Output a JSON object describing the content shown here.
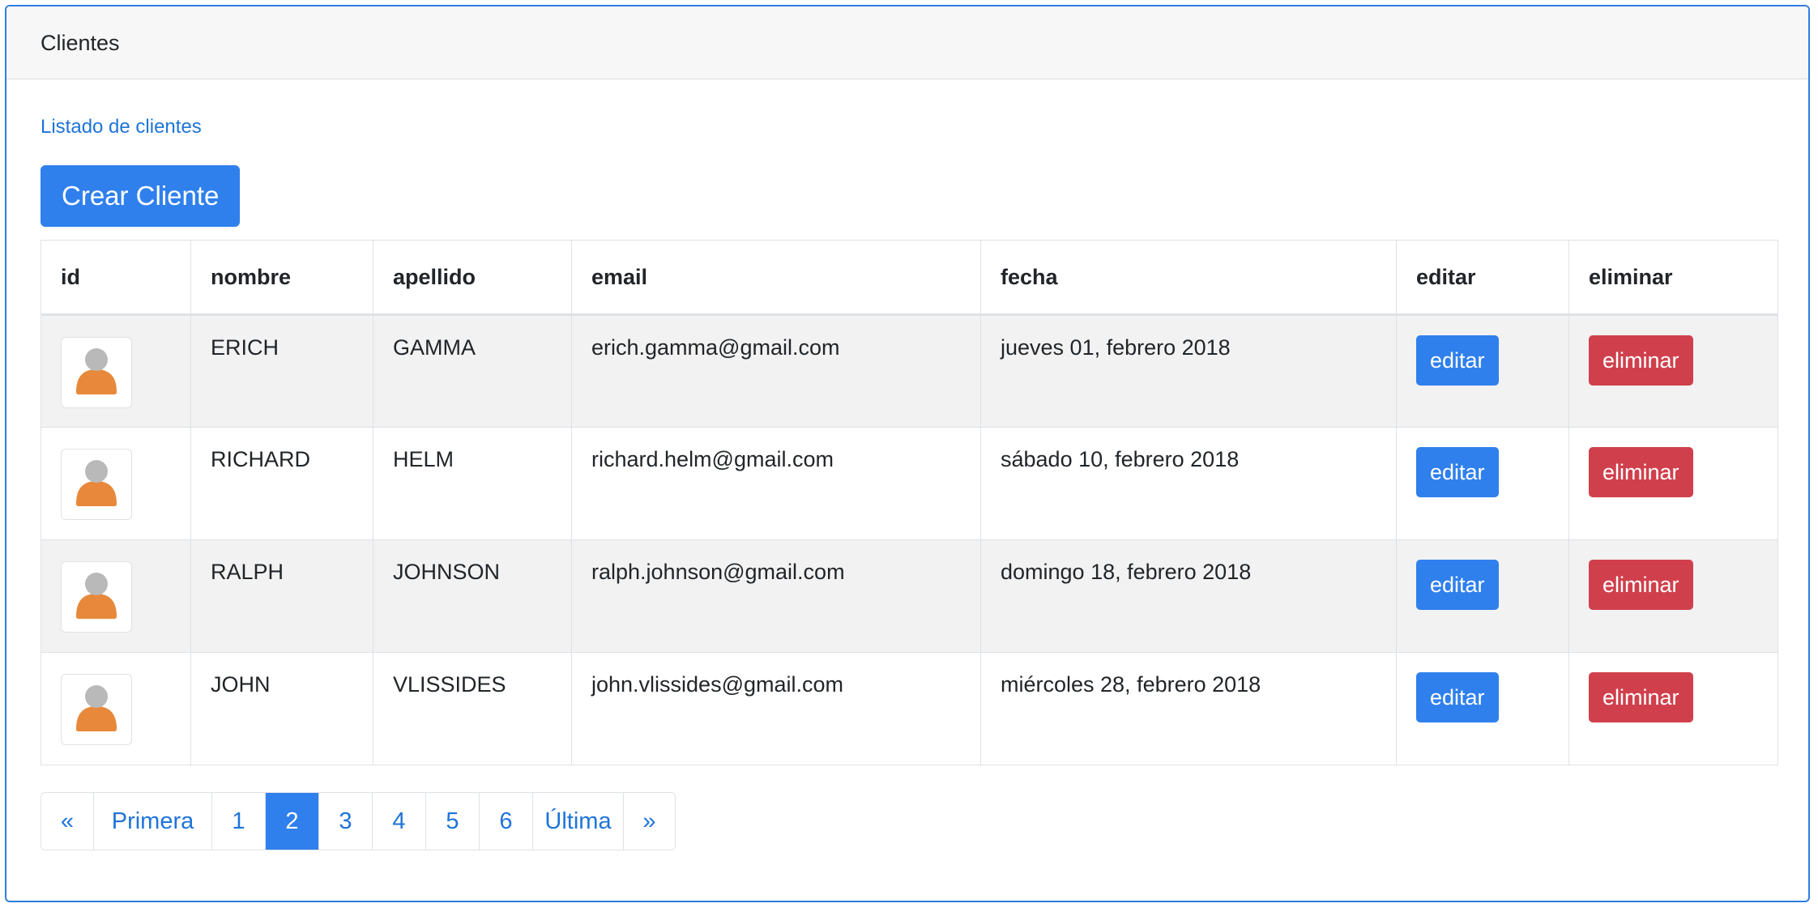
{
  "card": {
    "title": "Clientes"
  },
  "subtitle": "Listado de clientes",
  "create_button": "Crear Cliente",
  "table": {
    "headers": [
      "id",
      "nombre",
      "apellido",
      "email",
      "fecha",
      "editar",
      "eliminar"
    ],
    "rows": [
      {
        "nombre": "ERICH",
        "apellido": "GAMMA",
        "email": "erich.gamma@gmail.com",
        "fecha": "jueves 01, febrero 2018",
        "edit": "editar",
        "delete": "eliminar"
      },
      {
        "nombre": "RICHARD",
        "apellido": "HELM",
        "email": "richard.helm@gmail.com",
        "fecha": "sábado 10, febrero 2018",
        "edit": "editar",
        "delete": "eliminar"
      },
      {
        "nombre": "RALPH",
        "apellido": "JOHNSON",
        "email": "ralph.johnson@gmail.com",
        "fecha": "domingo 18, febrero 2018",
        "edit": "editar",
        "delete": "eliminar"
      },
      {
        "nombre": "JOHN",
        "apellido": "VLISSIDES",
        "email": "john.vlissides@gmail.com",
        "fecha": "miércoles 28, febrero 2018",
        "edit": "editar",
        "delete": "eliminar"
      }
    ]
  },
  "pagination": {
    "items": [
      "«",
      "Primera",
      "1",
      "2",
      "3",
      "4",
      "5",
      "6",
      "Última",
      "»"
    ],
    "active": "2"
  },
  "colors": {
    "primary": "#2f80ed",
    "danger": "#d0404c",
    "link": "#1e74d8",
    "card_border": "#2f7ee0",
    "avatar_body": "#e8883a",
    "avatar_head": "#b9b9b9"
  },
  "icons": {
    "avatar": "user-avatar-icon"
  }
}
